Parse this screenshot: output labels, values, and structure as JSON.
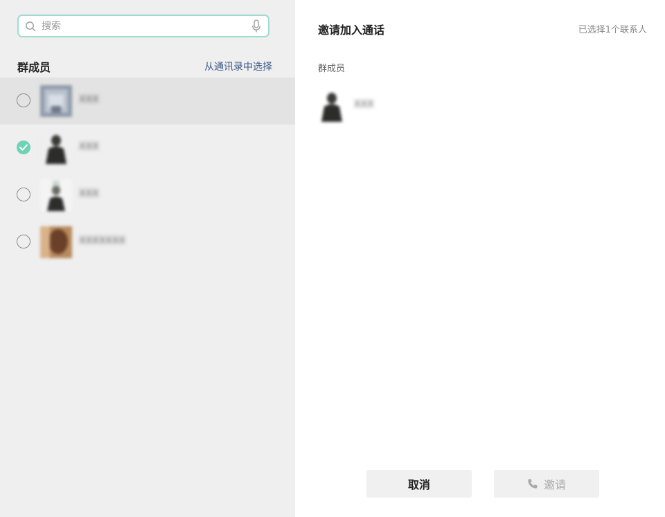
{
  "search": {
    "placeholder": "搜索"
  },
  "left": {
    "section_title": "群成员",
    "contacts_link": "从通讯录中选择",
    "members": [
      {
        "name": "XXX",
        "checked": false,
        "hover": true
      },
      {
        "name": "XXX",
        "checked": true,
        "hover": false
      },
      {
        "name": "XXX",
        "checked": false,
        "hover": false
      },
      {
        "name": "XXXXXXX",
        "checked": false,
        "hover": false
      }
    ]
  },
  "right": {
    "title": "邀请加入通话",
    "selected_count": "已选择1个联系人",
    "section_title": "群成员",
    "selected_member": {
      "name": "XXX"
    }
  },
  "buttons": {
    "cancel": "取消",
    "invite": "邀请"
  },
  "colors": {
    "accent": "#6fd2b3",
    "link": "#3d5a86",
    "search_border": "#9fdcd0"
  },
  "icons": {
    "search": "search-icon",
    "mic": "microphone-icon",
    "check": "check-icon",
    "phone": "phone-icon"
  }
}
